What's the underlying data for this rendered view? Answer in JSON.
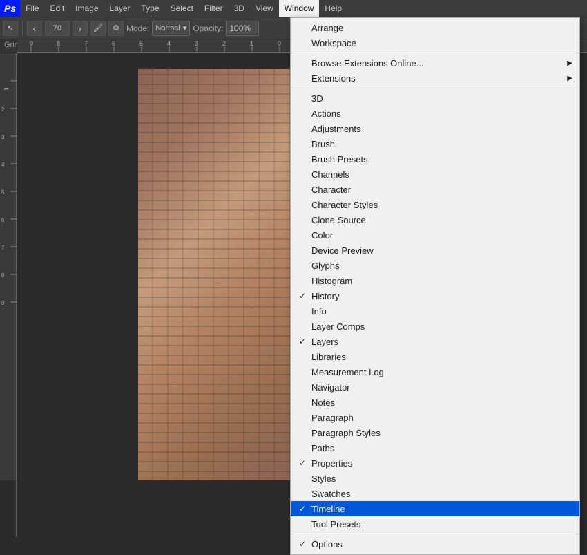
{
  "app": {
    "logo": "Ps"
  },
  "menubar": {
    "items": [
      {
        "id": "file",
        "label": "File"
      },
      {
        "id": "edit",
        "label": "Edit"
      },
      {
        "id": "image",
        "label": "Image"
      },
      {
        "id": "layer",
        "label": "Layer"
      },
      {
        "id": "type",
        "label": "Type"
      },
      {
        "id": "select",
        "label": "Select"
      },
      {
        "id": "filter",
        "label": "Filter"
      },
      {
        "id": "3d",
        "label": "3D"
      },
      {
        "id": "view",
        "label": "View"
      },
      {
        "id": "window",
        "label": "Window",
        "active": true
      },
      {
        "id": "help",
        "label": "Help"
      }
    ]
  },
  "toolbar": {
    "size_label": "70",
    "mode_label": "Mode:",
    "mode_value": "Normal",
    "opacity_label": "Opacity:",
    "opacity_value": "100%"
  },
  "infobar": {
    "text": "Grindon Hall Date unknown but probably around turn of the century, certain"
  },
  "window_menu": {
    "sections": [
      {
        "items": [
          {
            "id": "arrange",
            "label": "Arrange",
            "checked": false
          },
          {
            "id": "workspace",
            "label": "Workspace",
            "checked": false
          }
        ]
      },
      {
        "items": [
          {
            "id": "browse-ext",
            "label": "Browse Extensions Online...",
            "checked": false
          },
          {
            "id": "extensions",
            "label": "Extensions",
            "checked": false
          }
        ]
      },
      {
        "items": [
          {
            "id": "3d",
            "label": "3D",
            "checked": false
          },
          {
            "id": "actions",
            "label": "Actions",
            "checked": false
          },
          {
            "id": "adjustments",
            "label": "Adjustments",
            "checked": false
          },
          {
            "id": "brush",
            "label": "Brush",
            "checked": false
          },
          {
            "id": "brush-presets",
            "label": "Brush Presets",
            "checked": false
          },
          {
            "id": "channels",
            "label": "Channels",
            "checked": false
          },
          {
            "id": "character",
            "label": "Character",
            "checked": false
          },
          {
            "id": "character-styles",
            "label": "Character Styles",
            "checked": false
          },
          {
            "id": "clone-source",
            "label": "Clone Source",
            "checked": false
          },
          {
            "id": "color",
            "label": "Color",
            "checked": false
          },
          {
            "id": "device-preview",
            "label": "Device Preview",
            "checked": false
          },
          {
            "id": "glyphs",
            "label": "Glyphs",
            "checked": false
          },
          {
            "id": "histogram",
            "label": "Histogram",
            "checked": false
          },
          {
            "id": "history",
            "label": "History",
            "checked": true
          },
          {
            "id": "info",
            "label": "Info",
            "checked": false
          },
          {
            "id": "layer-comps",
            "label": "Layer Comps",
            "checked": false
          },
          {
            "id": "layers",
            "label": "Layers",
            "checked": true
          },
          {
            "id": "libraries",
            "label": "Libraries",
            "checked": false
          },
          {
            "id": "measurement-log",
            "label": "Measurement Log",
            "checked": false
          },
          {
            "id": "navigator",
            "label": "Navigator",
            "checked": false
          },
          {
            "id": "notes",
            "label": "Notes",
            "checked": false
          },
          {
            "id": "paragraph",
            "label": "Paragraph",
            "checked": false
          },
          {
            "id": "paragraph-styles",
            "label": "Paragraph Styles",
            "checked": false
          },
          {
            "id": "paths",
            "label": "Paths",
            "checked": false
          },
          {
            "id": "properties",
            "label": "Properties",
            "checked": true
          },
          {
            "id": "styles",
            "label": "Styles",
            "checked": false
          },
          {
            "id": "swatches",
            "label": "Swatches",
            "checked": false
          },
          {
            "id": "timeline",
            "label": "Timeline",
            "checked": true,
            "active": true
          },
          {
            "id": "tool-presets",
            "label": "Tool Presets",
            "checked": false
          }
        ]
      },
      {
        "items": [
          {
            "id": "options",
            "label": "Options",
            "checked": true
          }
        ]
      }
    ]
  }
}
